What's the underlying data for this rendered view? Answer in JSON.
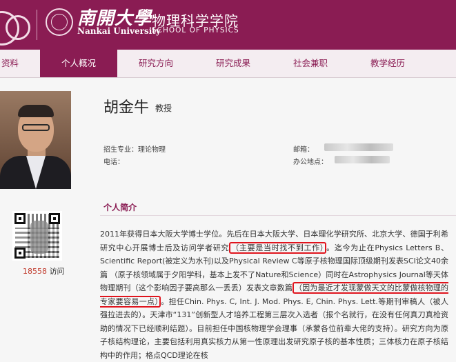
{
  "header": {
    "university_cn": "南開大學",
    "school_cn": "物理科学学院",
    "university_en": "Nankai University",
    "school_en": "SCHOOL OF PHYSICS",
    "brand_color": "#8a1c53"
  },
  "nav": {
    "items": [
      {
        "label": "资料"
      },
      {
        "label": "个人概况"
      },
      {
        "label": "研究方向"
      },
      {
        "label": "研究成果"
      },
      {
        "label": "社会兼职"
      },
      {
        "label": "教学经历"
      }
    ],
    "active_index": 1
  },
  "profile": {
    "name": "胡金牛",
    "title": "教授",
    "major_label": "招生专业：",
    "major_value": "理论物理",
    "phone_label": "电话：",
    "email_label": "邮箱：",
    "office_label": "办公地点："
  },
  "stats": {
    "visits": "18558",
    "visits_label": "访问"
  },
  "intro": {
    "heading": "个人简介",
    "p1_a": "2011年获得日本大阪大学博士学位。先后在日本大阪大学、日本理化学研究所、北京大学、德国于利希研究中心开展博士后及访问学者研究",
    "p1_hl1": "（主要是当时找不到工作）",
    "p1_b": "。迄今为止在Physics Letters B、Scientific Report(被定义为水刊)以及Physical Review C等原子核物理国际顶级期刊发表SCI论文40余篇 （原子核领域属于夕阳学科，基本上发不了Nature和Science）同时在Astrophysics Journal等天体物理期刊（这个影响因子要高那么一丢丢）发表文章数篇",
    "p1_hl2": "（因为最近才发现蒙做天文的比蒙做核物理的专家要容易一点）",
    "p1_c": "。担任Chin. Phys. C, Int. J. Mod. Phys. E, Chin. Phys. Lett.等期刊审稿人（被人强拉进去的）。天津市“131”创新型人才培养工程第三层次入选者（报个名就行，在没有任何真刀真枪资助的情况下已经顺利结题）。目前担任中国核物理学会理事（承蒙各位前辈大佬的支持）。研究方向为原子核结构理论，主要包括利用真实核力从第一性原理出发研究原子核的基本性质；三体核力在原子核结构中的作用；格点QCD理论在核"
  }
}
